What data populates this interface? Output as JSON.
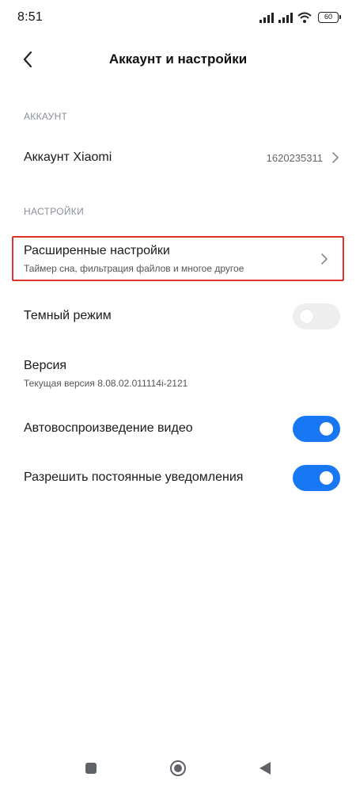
{
  "status_bar": {
    "time": "8:51",
    "battery": "60"
  },
  "header": {
    "title": "Аккаунт и настройки"
  },
  "account_section": {
    "label": "АККАУНТ",
    "account_row": {
      "title": "Аккаунт Xiaomi",
      "value": "1620235311"
    }
  },
  "settings_section": {
    "label": "НАСТРОЙКИ",
    "advanced": {
      "title": "Расширенные настройки",
      "subtitle": "Таймер сна, фильтрация файлов и многое другое"
    },
    "dark_mode": {
      "title": "Темный режим",
      "enabled": false
    },
    "version": {
      "title": "Версия",
      "subtitle": "Текущая версия 8.08.02.011114i-2121"
    },
    "autoplay": {
      "title": "Автовоспроизведение видео",
      "enabled": true
    },
    "notifications": {
      "title": "Разрешить постоянные уведомления",
      "enabled": true
    }
  },
  "colors": {
    "accent": "#1877f2",
    "highlight": "#e0312b",
    "section_label": "#8a8f99"
  },
  "icons": [
    "back-chevron-icon",
    "chevron-right-icon",
    "signal-icon",
    "wifi-icon",
    "battery-icon",
    "nav-square-icon",
    "nav-home-icon",
    "nav-back-icon"
  ]
}
